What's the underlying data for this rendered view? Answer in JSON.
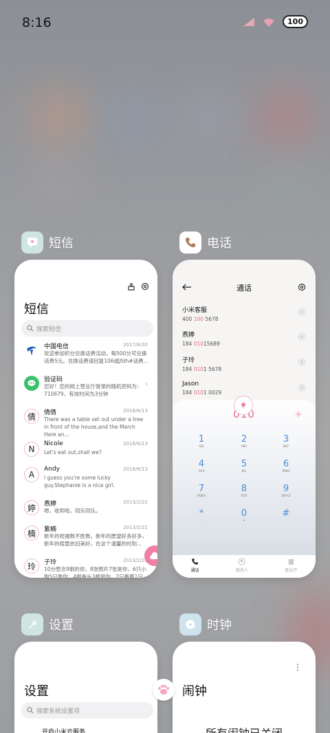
{
  "status_bar": {
    "time": "8:16",
    "battery": "100"
  },
  "sms_app": {
    "name": "短信",
    "title": "短信",
    "search_placeholder": "搜索短信",
    "messages": [
      {
        "avatar": "",
        "name": "中国电信",
        "date": "2017/6/30",
        "text": "欢迎参加积分兑换话费活动，每500分可兑换话费5元。兑换话费请回复106或jfdh#话费..."
      },
      {
        "avatar": "",
        "name": "验证码",
        "date": "",
        "text": "您好！您的网上营业厅登录的随机密码为：710679，有效时间为3分钟"
      },
      {
        "avatar": "倩",
        "name": "倩倩",
        "date": "2016/6/13",
        "text": "There was a table set out under a tree in front of the house,and the March Hare an..."
      },
      {
        "avatar": "N",
        "name": "Nicole",
        "date": "2016/6/13",
        "text": "Let's eat out,shall we?"
      },
      {
        "avatar": "A",
        "name": "Andy",
        "date": "2016/6/13",
        "text": "I guess you're some lucky guy.Stephanie is a nice girl."
      },
      {
        "avatar": "婷",
        "name": "燕婷",
        "date": "2013/2/22",
        "text": "嗯，收到啦，同乐同乐。"
      },
      {
        "avatar": "楠",
        "name": "紫楠",
        "date": "2013/2/22",
        "text": "新年的祝福数不胜数，新年的愿望好多好多，新年的喧嚣依旧美好，在这个温馨的时刻..."
      },
      {
        "avatar": "玲",
        "name": "子玲",
        "date": "2013/2/22",
        "text": "10分憋念9剔的你，8张照片7张是你，6只小狗5只像你，4根骨头3根留你，2只看着1只..."
      }
    ]
  },
  "phone_app": {
    "name": "电话",
    "title": "通话",
    "contacts": [
      {
        "name": "小米客服",
        "pre": "400 ",
        "hl": "100",
        "post": " 5678"
      },
      {
        "name": "燕婷",
        "pre": "184 ",
        "hl": "010",
        "post": "15689"
      },
      {
        "name": "子玲",
        "pre": "184 ",
        "hl": "010",
        "post": "1 5678"
      },
      {
        "name": "Jason",
        "pre": "184 ",
        "hl": "010",
        "post": "1 0029"
      }
    ],
    "dial_number": "010",
    "keys": [
      {
        "d": "1",
        "l": "QΩ"
      },
      {
        "d": "2",
        "l": "ABC"
      },
      {
        "d": "3",
        "l": "DEF"
      },
      {
        "d": "4",
        "l": "GHI"
      },
      {
        "d": "5",
        "l": "JKL"
      },
      {
        "d": "6",
        "l": "MNO"
      },
      {
        "d": "7",
        "l": "PQRS"
      },
      {
        "d": "8",
        "l": "TUV"
      },
      {
        "d": "9",
        "l": "WXYZ"
      },
      {
        "d": "*",
        "l": ","
      },
      {
        "d": "0",
        "l": "+"
      },
      {
        "d": "#",
        "l": ""
      }
    ],
    "tabs": [
      "通话",
      "联系人",
      "营业厅"
    ]
  },
  "settings_app": {
    "name": "设置",
    "title": "设置",
    "search_placeholder": "搜索系统设置项",
    "first_item": "开启小米云服务"
  },
  "clock_app": {
    "name": "时钟",
    "title": "闹钟",
    "status": "所有闹钟已关闭"
  },
  "colors": {
    "accent_pink": "#e46a86",
    "key_blue": "#4a8fd8"
  }
}
